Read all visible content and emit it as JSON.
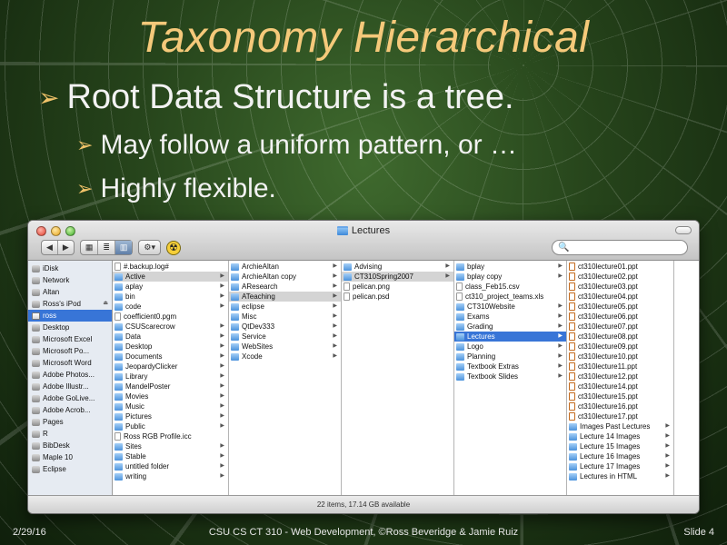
{
  "slide": {
    "title": "Taxonomy Hierarchical",
    "bullets": [
      "Root Data Structure is a tree.",
      "May follow a uniform pattern, or …",
      "Highly flexible."
    ],
    "bullet_glyph": "➢",
    "footer": {
      "date": "2/29/16",
      "center": "CSU CS CT 310 - Web Development, ©Ross Beveridge & Jamie Ruiz",
      "slide": "Slide 4"
    },
    "colors": {
      "title": "#f5c97a",
      "bullet_arrow": "#f2c46a",
      "text": "#f2f2f2"
    }
  },
  "finder": {
    "window_title": "Lectures",
    "toolbar": {
      "back": "◀",
      "forward": "▶",
      "view_icon": "▦",
      "view_list": "≣",
      "view_columns": "▥",
      "action": "⚙▾",
      "radiation": "☢",
      "search_icon": "🔍"
    },
    "status": "22 items, 17.14 GB available",
    "sidebar": [
      {
        "label": "iDisk",
        "icon": "idisk-icon"
      },
      {
        "label": "Network",
        "icon": "network-icon"
      },
      {
        "label": "Altan",
        "icon": "disk-icon"
      },
      {
        "label": "Ross's iPod",
        "icon": "ipod-icon",
        "eject": "⏏"
      },
      {
        "label": "ross",
        "icon": "home-icon",
        "selected": true
      },
      {
        "label": "Desktop",
        "icon": "desktop-icon"
      },
      {
        "label": "Microsoft Excel",
        "icon": "excel-icon"
      },
      {
        "label": "Microsoft Po...",
        "icon": "powerpoint-icon"
      },
      {
        "label": "Microsoft Word",
        "icon": "word-icon"
      },
      {
        "label": "Adobe Photos...",
        "icon": "photoshop-icon"
      },
      {
        "label": "Adobe Illustr...",
        "icon": "illustrator-icon"
      },
      {
        "label": "Adobe GoLive...",
        "icon": "golive-icon"
      },
      {
        "label": "Adobe Acrob...",
        "icon": "acrobat-icon"
      },
      {
        "label": "Pages",
        "icon": "pages-icon"
      },
      {
        "label": "R",
        "icon": "r-icon"
      },
      {
        "label": "BibDesk",
        "icon": "bibdesk-icon"
      },
      {
        "label": "Maple 10",
        "icon": "maple-icon"
      },
      {
        "label": "Eclipse",
        "icon": "eclipse-icon"
      }
    ],
    "columns": [
      [
        {
          "label": "#.backup.log#",
          "kind": "file"
        },
        {
          "label": "Active",
          "kind": "folder",
          "chev": true,
          "state": "hl"
        },
        {
          "label": "aplay",
          "kind": "folder",
          "chev": true
        },
        {
          "label": "bin",
          "kind": "folder",
          "chev": true
        },
        {
          "label": "code",
          "kind": "folder",
          "chev": true
        },
        {
          "label": "coefficient0.pgm",
          "kind": "file"
        },
        {
          "label": "CSUScarecrow",
          "kind": "folder",
          "chev": true
        },
        {
          "label": "Data",
          "kind": "folder",
          "chev": true
        },
        {
          "label": "Desktop",
          "kind": "folder",
          "chev": true
        },
        {
          "label": "Documents",
          "kind": "folder",
          "chev": true
        },
        {
          "label": "JeopardyClicker",
          "kind": "folder",
          "chev": true
        },
        {
          "label": "Library",
          "kind": "folder",
          "chev": true
        },
        {
          "label": "MandelPoster",
          "kind": "folder",
          "chev": true
        },
        {
          "label": "Movies",
          "kind": "folder",
          "chev": true
        },
        {
          "label": "Music",
          "kind": "folder",
          "chev": true
        },
        {
          "label": "Pictures",
          "kind": "folder",
          "chev": true
        },
        {
          "label": "Public",
          "kind": "folder",
          "chev": true
        },
        {
          "label": "Ross RGB Profile.icc",
          "kind": "file"
        },
        {
          "label": "Sites",
          "kind": "folder",
          "chev": true
        },
        {
          "label": "Stable",
          "kind": "folder",
          "chev": true
        },
        {
          "label": "untitled folder",
          "kind": "folder",
          "chev": true
        },
        {
          "label": "writing",
          "kind": "folder",
          "chev": true
        }
      ],
      [
        {
          "label": "ArchieAltan",
          "kind": "folder",
          "chev": true
        },
        {
          "label": "ArchieAltan copy",
          "kind": "folder",
          "chev": true
        },
        {
          "label": "AResearch",
          "kind": "folder",
          "chev": true
        },
        {
          "label": "ATeaching",
          "kind": "folder",
          "chev": true,
          "state": "hl"
        },
        {
          "label": "eclipse",
          "kind": "folder",
          "chev": true
        },
        {
          "label": "Misc",
          "kind": "folder",
          "chev": true
        },
        {
          "label": "QtDev333",
          "kind": "folder",
          "chev": true
        },
        {
          "label": "Service",
          "kind": "folder",
          "chev": true
        },
        {
          "label": "WebSites",
          "kind": "folder",
          "chev": true
        },
        {
          "label": "Xcode",
          "kind": "folder",
          "chev": true
        }
      ],
      [
        {
          "label": "Advising",
          "kind": "folder",
          "chev": true
        },
        {
          "label": "CT310Spring2007",
          "kind": "folder",
          "chev": true,
          "state": "hl"
        },
        {
          "label": "pelican.png",
          "kind": "file"
        },
        {
          "label": "pelican.psd",
          "kind": "file"
        }
      ],
      [
        {
          "label": "bplay",
          "kind": "folder",
          "chev": true
        },
        {
          "label": "bplay copy",
          "kind": "folder",
          "chev": true
        },
        {
          "label": "class_Feb15.csv",
          "kind": "file"
        },
        {
          "label": "ct310_project_teams.xls",
          "kind": "file"
        },
        {
          "label": "CT310Website",
          "kind": "folder",
          "chev": true
        },
        {
          "label": "Exams",
          "kind": "folder",
          "chev": true
        },
        {
          "label": "Grading",
          "kind": "folder",
          "chev": true
        },
        {
          "label": "Lectures",
          "kind": "folder",
          "chev": true,
          "state": "sel"
        },
        {
          "label": "Logo",
          "kind": "folder",
          "chev": true
        },
        {
          "label": "Planning",
          "kind": "folder",
          "chev": true
        },
        {
          "label": "Textbook Extras",
          "kind": "folder",
          "chev": true
        },
        {
          "label": "Textbook Slides",
          "kind": "folder",
          "chev": true
        }
      ],
      [
        {
          "label": "ct310lecture01.ppt",
          "kind": "ppt"
        },
        {
          "label": "ct310lecture02.ppt",
          "kind": "ppt"
        },
        {
          "label": "ct310lecture03.ppt",
          "kind": "ppt"
        },
        {
          "label": "ct310lecture04.ppt",
          "kind": "ppt"
        },
        {
          "label": "ct310lecture05.ppt",
          "kind": "ppt"
        },
        {
          "label": "ct310lecture06.ppt",
          "kind": "ppt"
        },
        {
          "label": "ct310lecture07.ppt",
          "kind": "ppt"
        },
        {
          "label": "ct310lecture08.ppt",
          "kind": "ppt"
        },
        {
          "label": "ct310lecture09.ppt",
          "kind": "ppt"
        },
        {
          "label": "ct310lecture10.ppt",
          "kind": "ppt"
        },
        {
          "label": "ct310lecture11.ppt",
          "kind": "ppt"
        },
        {
          "label": "ct310lecture12.ppt",
          "kind": "ppt"
        },
        {
          "label": "ct310lecture14.ppt",
          "kind": "ppt"
        },
        {
          "label": "ct310lecture15.ppt",
          "kind": "ppt"
        },
        {
          "label": "ct310lecture16.ppt",
          "kind": "ppt"
        },
        {
          "label": "ct310lecture17.ppt",
          "kind": "ppt"
        },
        {
          "label": "Images Past Lectures",
          "kind": "folder",
          "chev": true
        },
        {
          "label": "Lecture 14 Images",
          "kind": "folder",
          "chev": true
        },
        {
          "label": "Lecture 15 Images",
          "kind": "folder",
          "chev": true
        },
        {
          "label": "Lecture 16 Images",
          "kind": "folder",
          "chev": true
        },
        {
          "label": "Lecture 17 Images",
          "kind": "folder",
          "chev": true
        },
        {
          "label": "Lectures in HTML",
          "kind": "folder",
          "chev": true
        }
      ]
    ]
  }
}
